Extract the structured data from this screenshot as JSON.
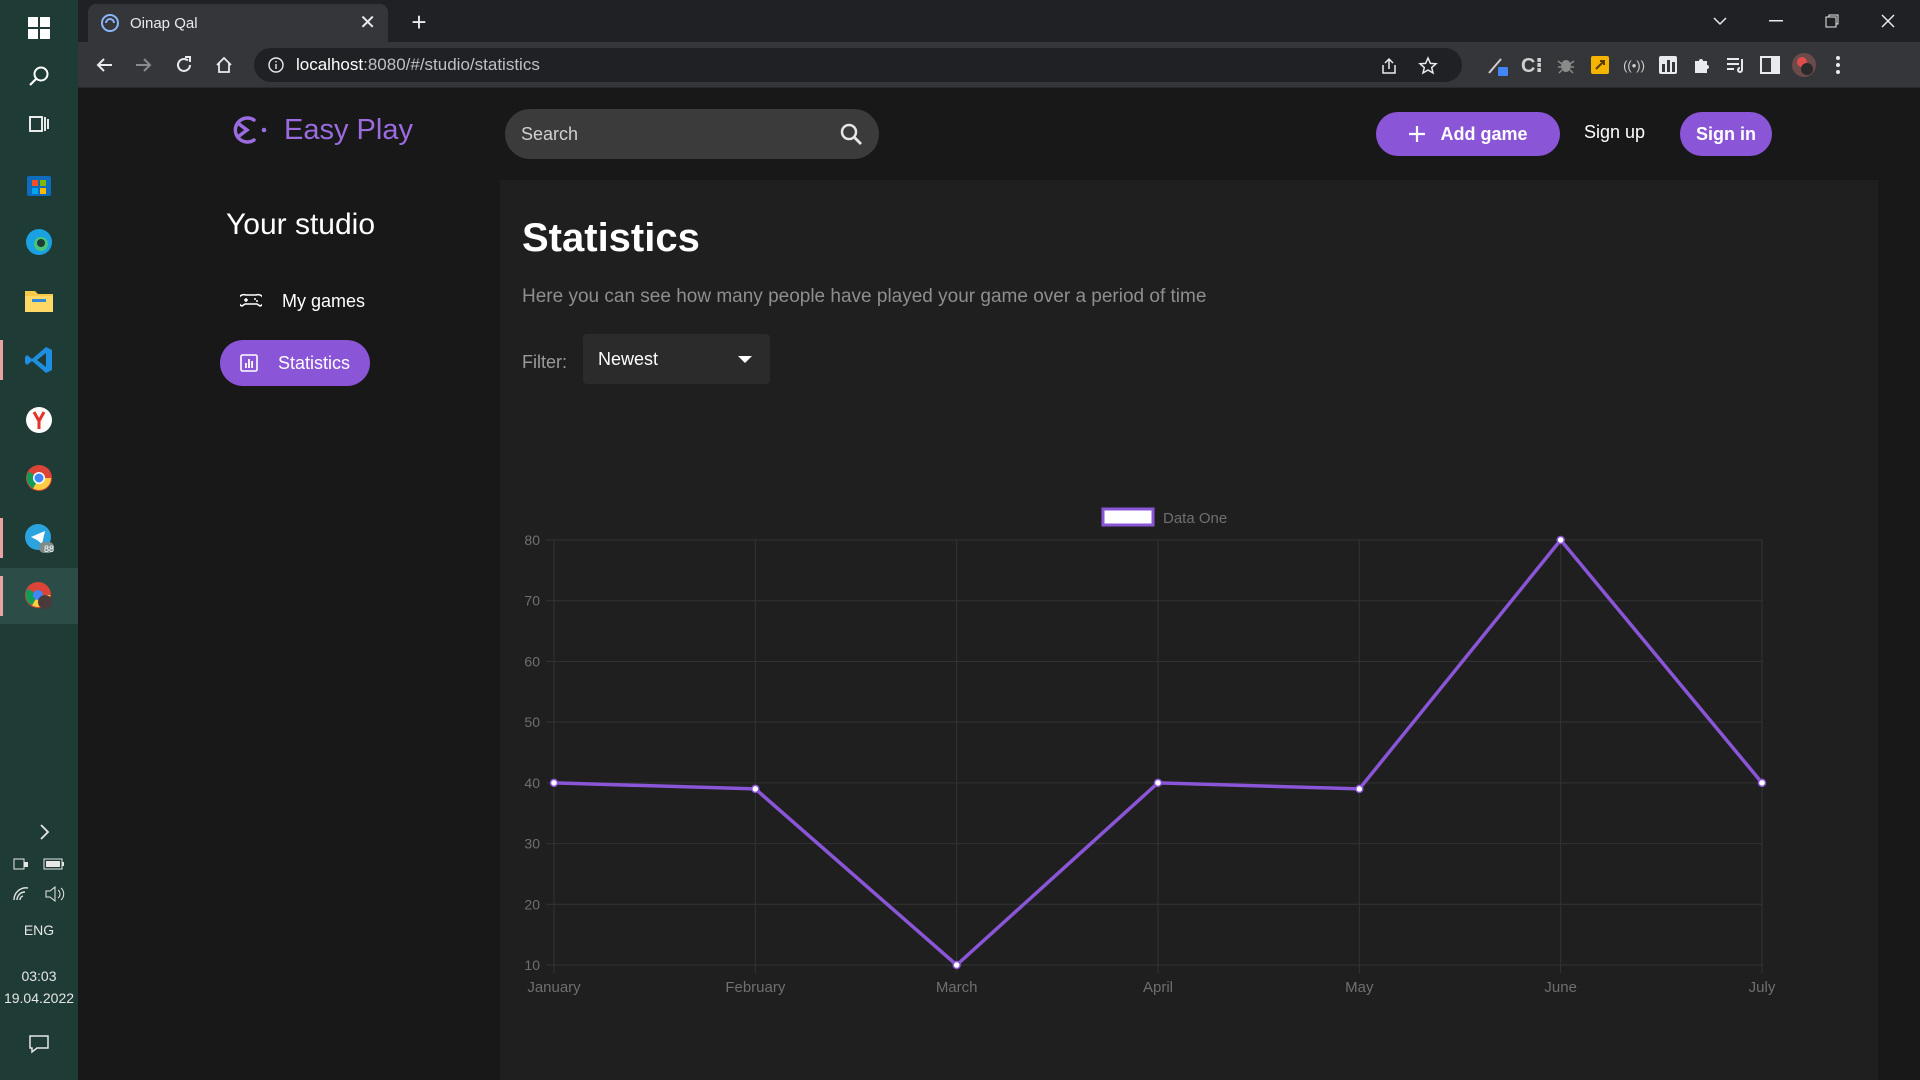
{
  "browser": {
    "tab_title": "Oinap Qal",
    "url_host": "localhost",
    "url_rest": ":8080/#/studio/statistics"
  },
  "taskbar": {
    "language": "ENG",
    "time": "03:03",
    "date": "19.04.2022",
    "telegram_badge": "88"
  },
  "header": {
    "logo_text": "Easy Play",
    "search_placeholder": "Search",
    "add_game_label": "Add game",
    "sign_up_label": "Sign up",
    "sign_in_label": "Sign in"
  },
  "sidebar": {
    "title": "Your studio",
    "items": [
      {
        "label": "My games",
        "icon": "gamepad-icon",
        "active": false
      },
      {
        "label": "Statistics",
        "icon": "bar-chart-icon",
        "active": true
      }
    ]
  },
  "main": {
    "title": "Statistics",
    "description": "Here you can see how many people have played your game over a period of time",
    "filter_label": "Filter:",
    "filter_value": "Newest"
  },
  "colors": {
    "accent": "#8a55d6",
    "page_bg": "#181818",
    "panel_bg": "#1f1f1f"
  },
  "chart_data": {
    "type": "line",
    "categories": [
      "January",
      "February",
      "March",
      "April",
      "May",
      "June",
      "July"
    ],
    "series": [
      {
        "name": "Data One",
        "values": [
          40,
          39,
          10,
          40,
          39,
          80,
          40
        ],
        "color": "#8a55d6"
      }
    ],
    "ylim": [
      10,
      80
    ],
    "yticks": [
      10,
      20,
      30,
      40,
      50,
      60,
      70,
      80
    ],
    "grid": true,
    "legend": "top-center"
  }
}
